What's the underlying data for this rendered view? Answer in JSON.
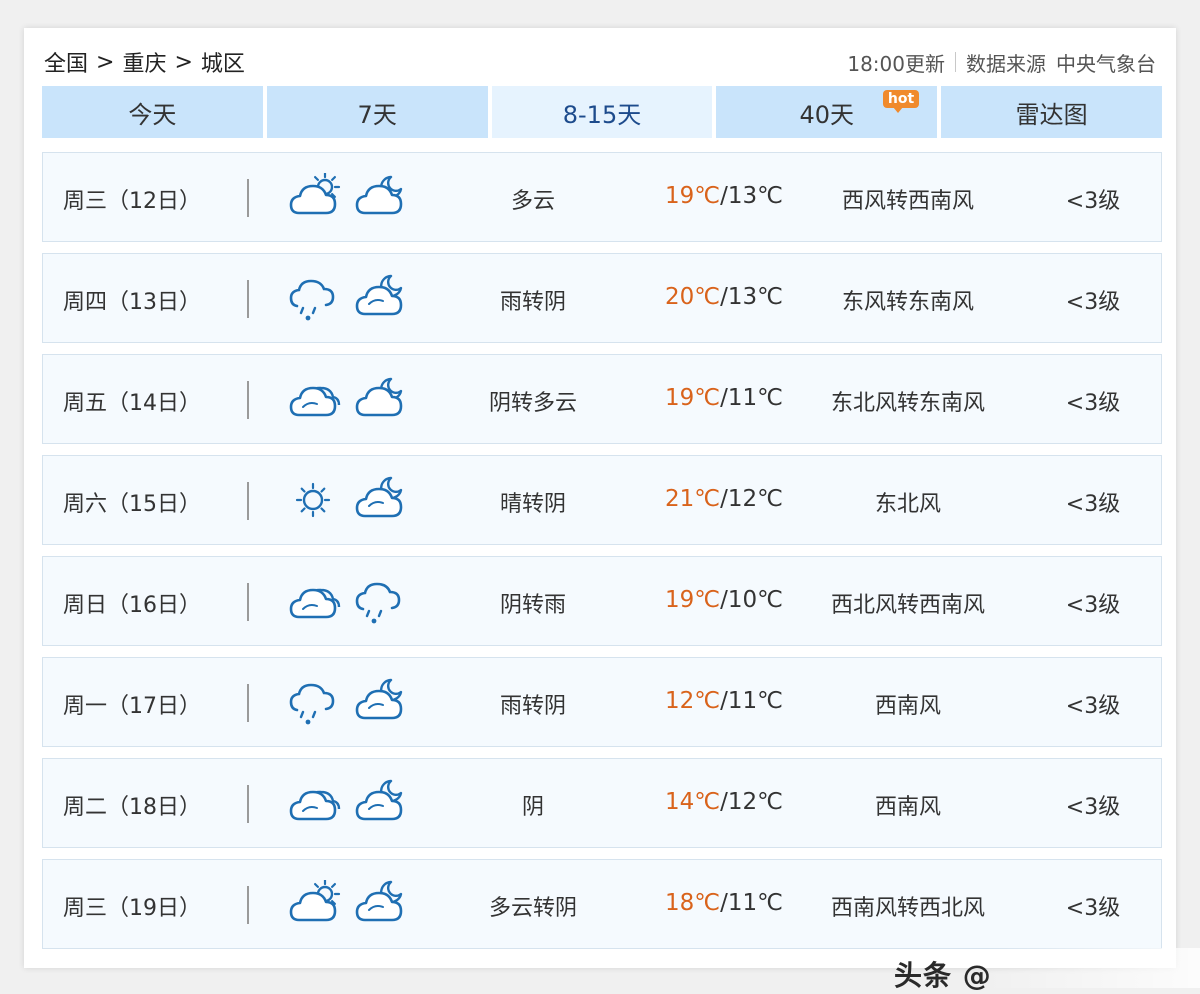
{
  "breadcrumb": {
    "items": [
      "全国",
      "重庆",
      "城区"
    ],
    "separator": ">"
  },
  "meta": {
    "update_time": "18:00更新",
    "source_label": "数据来源",
    "source_value": "中央气象台"
  },
  "tabs": [
    {
      "label": "今天",
      "active": false
    },
    {
      "label": "7天",
      "active": false
    },
    {
      "label": "8-15天",
      "active": true
    },
    {
      "label": "40天",
      "active": false,
      "badge": "hot"
    },
    {
      "label": "雷达图",
      "active": false
    }
  ],
  "days": [
    {
      "date": "周三（12日）",
      "day_icon": "partly-cloudy-day-icon",
      "night_icon": "partly-cloudy-night-icon",
      "desc": "多云",
      "high": "19℃",
      "low": "13℃",
      "wind": "西风转西南风",
      "level": "<3级"
    },
    {
      "date": "周四（13日）",
      "day_icon": "rain-icon",
      "night_icon": "overcast-night-icon",
      "desc": "雨转阴",
      "high": "20℃",
      "low": "13℃",
      "wind": "东风转东南风",
      "level": "<3级"
    },
    {
      "date": "周五（14日）",
      "day_icon": "overcast-icon",
      "night_icon": "partly-cloudy-night-icon",
      "desc": "阴转多云",
      "high": "19℃",
      "low": "11℃",
      "wind": "东北风转东南风",
      "level": "<3级"
    },
    {
      "date": "周六（15日）",
      "day_icon": "sunny-icon",
      "night_icon": "overcast-night-icon",
      "desc": "晴转阴",
      "high": "21℃",
      "low": "12℃",
      "wind": "东北风",
      "level": "<3级"
    },
    {
      "date": "周日（16日）",
      "day_icon": "overcast-icon",
      "night_icon": "rain-icon",
      "desc": "阴转雨",
      "high": "19℃",
      "low": "10℃",
      "wind": "西北风转西南风",
      "level": "<3级"
    },
    {
      "date": "周一（17日）",
      "day_icon": "rain-icon",
      "night_icon": "overcast-night-icon",
      "desc": "雨转阴",
      "high": "12℃",
      "low": "11℃",
      "wind": "西南风",
      "level": "<3级"
    },
    {
      "date": "周二（18日）",
      "day_icon": "overcast-icon",
      "night_icon": "overcast-night-icon",
      "desc": "阴",
      "high": "14℃",
      "low": "12℃",
      "wind": "西南风",
      "level": "<3级"
    },
    {
      "date": "周三（19日）",
      "day_icon": "partly-cloudy-day-icon",
      "night_icon": "overcast-night-icon",
      "desc": "多云转阴",
      "high": "18℃",
      "low": "11℃",
      "wind": "西南风转西北风",
      "level": "<3级"
    }
  ],
  "watermark": "头条 @",
  "colors": {
    "tab_bg": "#c9e4fb",
    "tab_active_bg": "#e6f3fe",
    "high_temp": "#d9631b",
    "icon_blue": "#1f6fb3",
    "hot_badge": "#f08a2c"
  }
}
